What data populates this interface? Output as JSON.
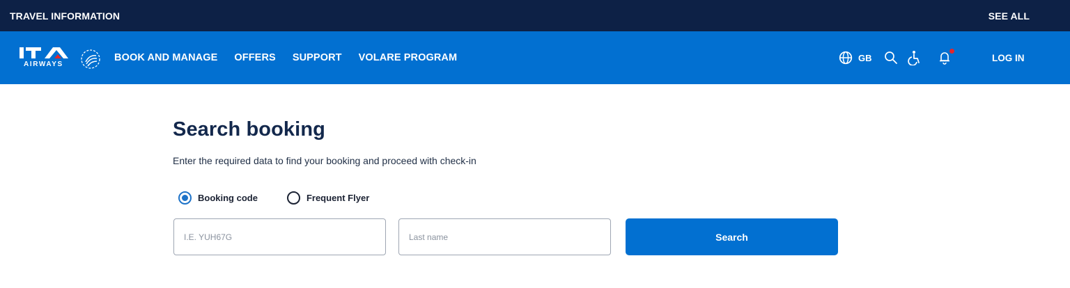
{
  "topbar": {
    "title": "TRAVEL INFORMATION",
    "see_all": "SEE ALL"
  },
  "nav": {
    "logo_text": "AIRWAYS",
    "links": [
      "BOOK AND MANAGE",
      "OFFERS",
      "SUPPORT",
      "VOLARE PROGRAM"
    ],
    "language": "GB",
    "icons": [
      "globe-icon",
      "search-icon",
      "accessibility-icon",
      "bell-icon"
    ],
    "login": "LOG IN"
  },
  "main": {
    "title": "Search booking",
    "subtitle": "Enter the required data to find your booking and proceed with check-in",
    "options": [
      {
        "label": "Booking code",
        "selected": true
      },
      {
        "label": "Frequent Flyer",
        "selected": false
      }
    ],
    "booking_code_placeholder": "I.E. YUH67G",
    "last_name_placeholder": "Last name",
    "search_label": "Search"
  },
  "colors": {
    "topbar": "#0d2146",
    "nav": "#0270d1",
    "accent": "#1e73c8",
    "notification": "#e3262c"
  }
}
